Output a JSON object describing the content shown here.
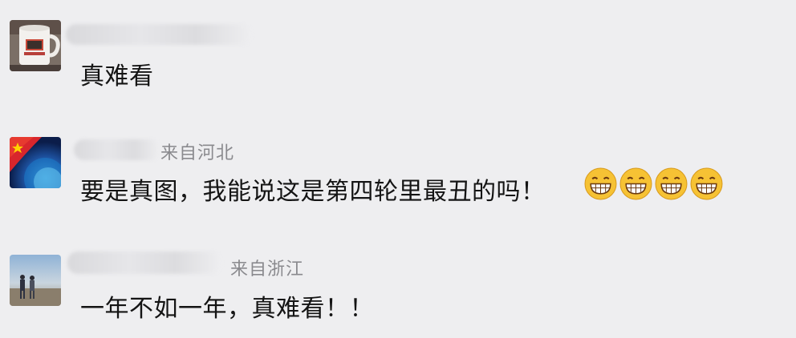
{
  "comments": [
    {
      "location": "",
      "text": "真难看",
      "avatar_icon": "mug-avatar-icon",
      "emojis": []
    },
    {
      "location": "来自河北",
      "text": "要是真图，我能说这是第四轮里最丑的吗！",
      "avatar_icon": "flag-globe-avatar-icon",
      "emojis": [
        "grin-emoji-icon",
        "grin-emoji-icon",
        "grin-emoji-icon",
        "grin-emoji-icon"
      ]
    },
    {
      "location": "来自浙江",
      "text": "一年不如一年，真难看！！",
      "avatar_icon": "couple-photo-avatar-icon",
      "emojis": []
    }
  ],
  "colors": {
    "background": "#eeeef0",
    "location_text": "#8a8a8e",
    "comment_text": "#141414",
    "emoji_yellow": "#f6c234"
  }
}
